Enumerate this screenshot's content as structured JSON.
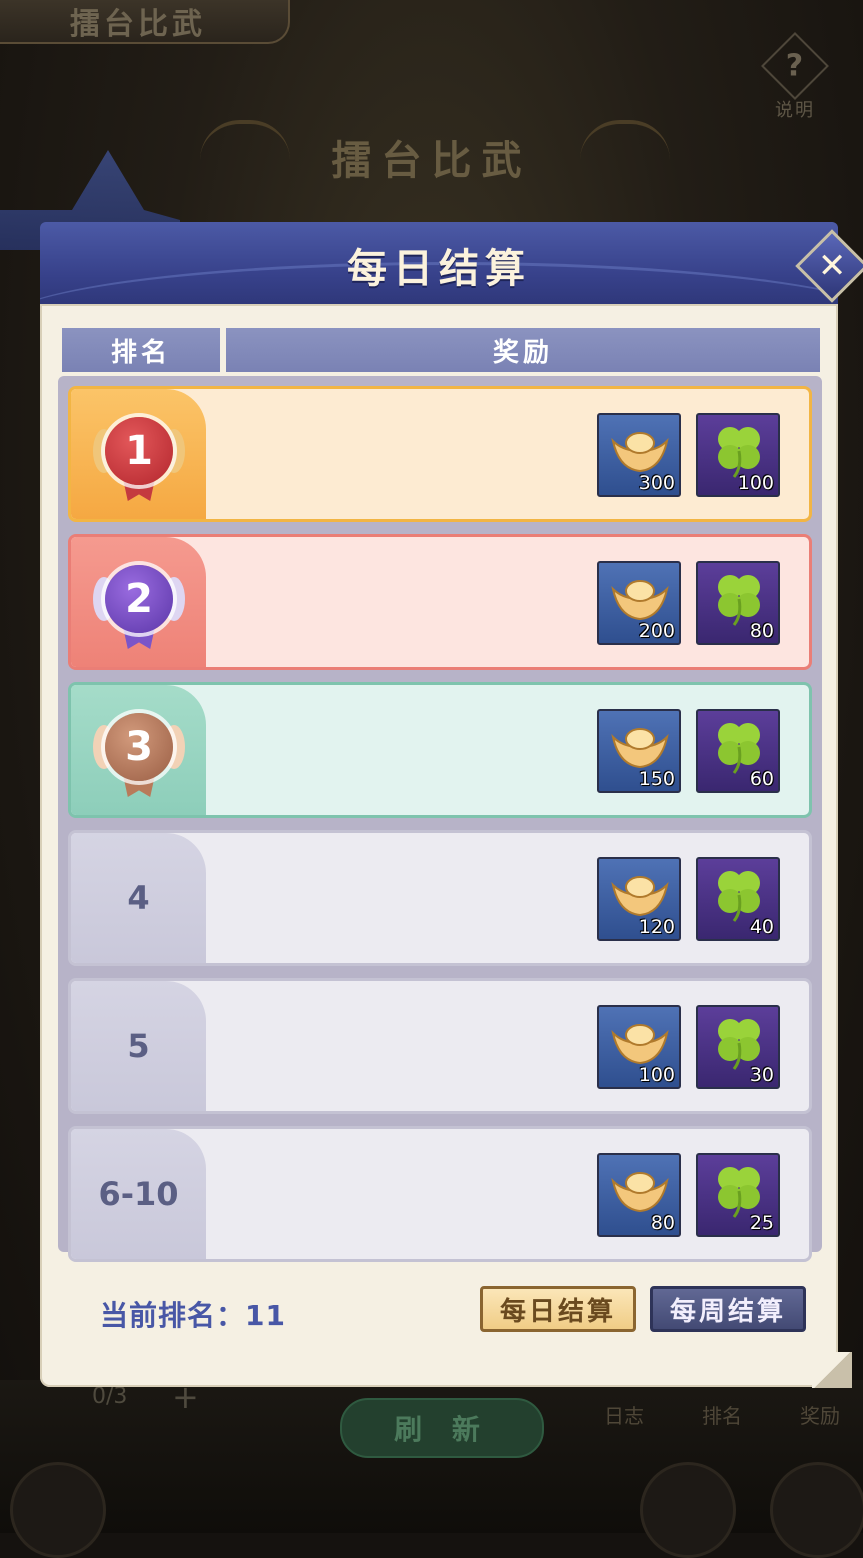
{
  "background": {
    "top_tab_label": "擂台比武",
    "help_label": "说明",
    "arena_title": "擂台比武",
    "attempts": "0/3",
    "refresh_label": "刷 新",
    "nav": [
      "日志",
      "排名",
      "奖励"
    ]
  },
  "modal": {
    "title": "每日结算",
    "close_icon": "close-icon",
    "columns": {
      "rank": "排名",
      "reward": "奖励"
    },
    "rows": [
      {
        "rank": "1",
        "style": "gold",
        "rewards": [
          {
            "icon": "gold-ingot-icon",
            "qty": "300"
          },
          {
            "icon": "clover-icon",
            "qty": "100"
          }
        ]
      },
      {
        "rank": "2",
        "style": "red",
        "rewards": [
          {
            "icon": "gold-ingot-icon",
            "qty": "200"
          },
          {
            "icon": "clover-icon",
            "qty": "80"
          }
        ]
      },
      {
        "rank": "3",
        "style": "green",
        "rewards": [
          {
            "icon": "gold-ingot-icon",
            "qty": "150"
          },
          {
            "icon": "clover-icon",
            "qty": "60"
          }
        ]
      },
      {
        "rank": "4",
        "style": "plain",
        "rewards": [
          {
            "icon": "gold-ingot-icon",
            "qty": "120"
          },
          {
            "icon": "clover-icon",
            "qty": "40"
          }
        ]
      },
      {
        "rank": "5",
        "style": "plain",
        "rewards": [
          {
            "icon": "gold-ingot-icon",
            "qty": "100"
          },
          {
            "icon": "clover-icon",
            "qty": "30"
          }
        ]
      },
      {
        "rank": "6-10",
        "style": "plain",
        "rewards": [
          {
            "icon": "gold-ingot-icon",
            "qty": "80"
          },
          {
            "icon": "clover-icon",
            "qty": "25"
          }
        ]
      }
    ],
    "current_rank_label": "当前排名：11",
    "tabs": {
      "daily": "每日结算",
      "weekly": "每周结算"
    },
    "colors": {
      "header_blue": "#37418a",
      "gold": "#f2b544",
      "red": "#ea7e76",
      "green": "#7ec3ad",
      "text_blue": "#4857a6"
    }
  }
}
